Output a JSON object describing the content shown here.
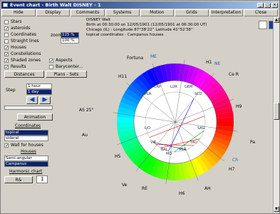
{
  "window": {
    "title": "Event chart - Birth Walt DISNEY - 1"
  },
  "menu": [
    "Hide",
    "Display",
    "Comments",
    "Systems",
    "Motion",
    "Grids",
    "Interpretation",
    "Close"
  ],
  "options": [
    {
      "label": "Stars",
      "checked": false
    },
    {
      "label": "asteroids",
      "checked": true
    },
    {
      "label": "Coordinates",
      "checked": false
    },
    {
      "label": "Straight lines",
      "checked": false
    },
    {
      "label": "Houses",
      "checked": true
    },
    {
      "label": "Constellations",
      "checked": true
    },
    {
      "label": "Shaded zones",
      "checked": true
    },
    {
      "label": "Results",
      "checked": true
    }
  ],
  "options2": [
    {
      "label": "Aspects",
      "checked": true
    },
    {
      "label": "Barycenter...",
      "checked": false
    }
  ],
  "zoom": {
    "label": "zoom",
    "v1": "125 %",
    "v2": "100 %"
  },
  "buttons": {
    "distances": "Distances",
    "plans": "Plans - Sets",
    "animation": "Animation",
    "coordinates": "Coordinates",
    "houses": "Houses",
    "harmonic": "Harmonic chart",
    "r": "R&"
  },
  "step": {
    "label": "Step",
    "v1": "1 hour",
    "v2": "1 day"
  },
  "coords": {
    "v1": "topical",
    "v2": "sideral"
  },
  "wall": {
    "label": "Wall for houses",
    "checked": true
  },
  "houses": {
    "v1": "Semi-angular",
    "v2": "Campanus"
  },
  "harmonic_value": "1",
  "info": {
    "l1": "DISNEY Walt",
    "l2": "Birth at 00:30:00 on 12/05/1901 (12/05/1901 at 06:30:00 UT)",
    "l3": "Chicago (IL) : Longitude 87°38'22'' Latitude 41°52'38''",
    "l4": "topical coordinates - Campanus houses"
  },
  "chart_labels": {
    "fortuna": "Fortuna",
    "ce": "Ce R",
    "as": "AS 25°",
    "au": "Au",
    "pa": "Pa",
    "ve": "Ve",
    "h1": "H1",
    "h2": "H2",
    "h3": "H3",
    "h4": "H4",
    "h5": "H5",
    "h6": "H6",
    "h7": "H7",
    "h8": "H8",
    "h9": "H9",
    "h10": "H10",
    "h11": "H11",
    "h12": "H12",
    "cap": "CAP",
    "pla": "PLA",
    "lio": "LIO",
    "gem": "GEM",
    "sco": "SCO",
    "sag": "SAG",
    "tau": "TAU",
    "vie": "VIE",
    "lur": "LUR",
    "bal": "BAL",
    "ver": "VER",
    "mo": "MO",
    "re": "RE",
    "ah": "AH",
    "ne": "NE",
    "me": "ME",
    "ch": "Ch"
  }
}
